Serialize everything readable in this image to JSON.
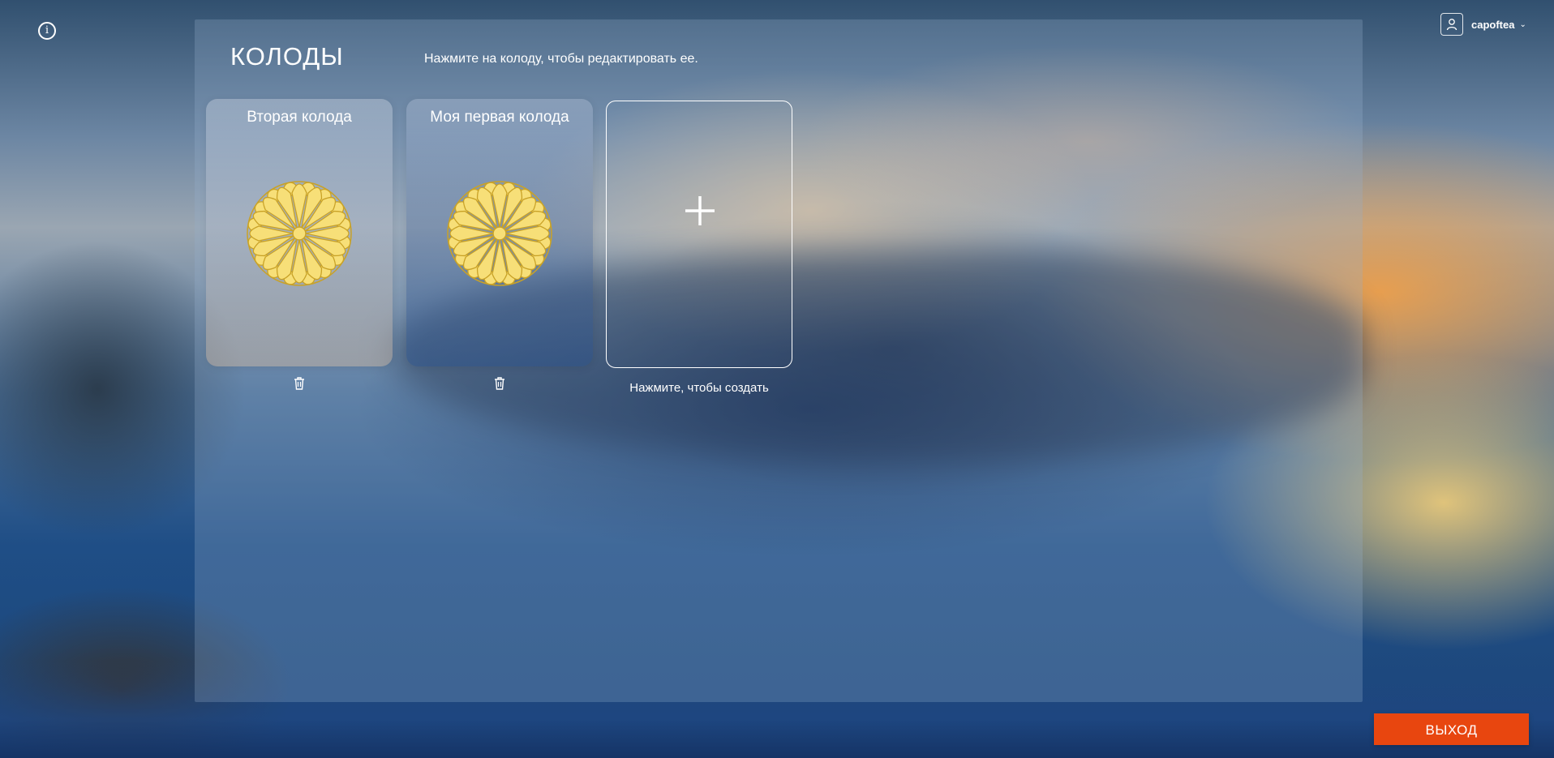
{
  "info_icon": "info-icon",
  "user": {
    "username": "capoftea",
    "avatar_icon": "user-icon",
    "dropdown_icon": "chevron-down-icon"
  },
  "page": {
    "title": "КОЛОДЫ",
    "hint": "Нажмите на колоду, чтобы редактировать ее."
  },
  "decks": [
    {
      "name": "Вторая колода",
      "emblem": "chrysanthemum-emblem",
      "delete_icon": "trash-icon"
    },
    {
      "name": "Моя первая колода",
      "emblem": "chrysanthemum-emblem",
      "delete_icon": "trash-icon"
    }
  ],
  "create_card": {
    "icon": "plus-icon",
    "label": "Нажмите, чтобы создать"
  },
  "exit_button": "ВЫХОД",
  "colors": {
    "exit_button": "#e8460f",
    "emblem_fill": "#f7df78",
    "emblem_stroke": "#c9a227"
  }
}
